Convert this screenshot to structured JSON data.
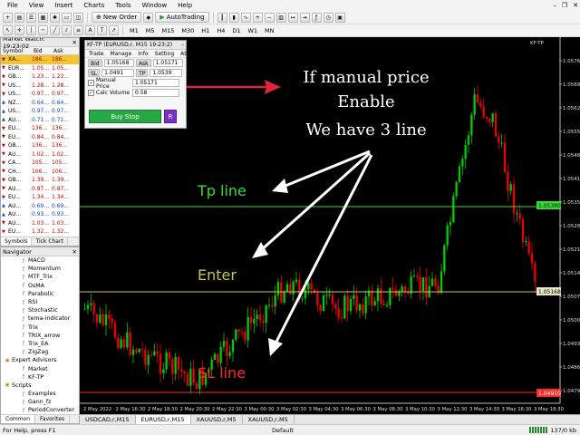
{
  "menu": [
    "File",
    "View",
    "Insert",
    "Charts",
    "Tools",
    "Window",
    "Help"
  ],
  "toolbar": {
    "new_order": "New Order",
    "autotrading": "AutoTrading",
    "timeframes": [
      "M1",
      "M5",
      "M15",
      "M30",
      "H1",
      "H4",
      "D1",
      "W1",
      "MN"
    ]
  },
  "market_watch": {
    "title": "Market Watch: 19:23:02",
    "headers": [
      "Symbol",
      "Bid",
      "Ask"
    ],
    "rows": [
      {
        "symbol": "XA...",
        "bid": "186...",
        "ask": "186...",
        "selected": true
      },
      {
        "symbol": "EUR...",
        "bid": "1.05...",
        "ask": "1.05..."
      },
      {
        "symbol": "GB...",
        "bid": "1.23...",
        "ask": "1.23..."
      },
      {
        "symbol": "US...",
        "bid": "1.28...",
        "ask": "1.28..."
      },
      {
        "symbol": "US...",
        "bid": "0.97...",
        "ask": "0.97..."
      },
      {
        "symbol": "NZ...",
        "bid": "0.64...",
        "ask": "0.64...",
        "blue": true
      },
      {
        "symbol": "US...",
        "bid": "0.97...",
        "ask": "0.97...",
        "blue": true
      },
      {
        "symbol": "AU...",
        "bid": "0.71...",
        "ask": "0.71...",
        "blue": true
      },
      {
        "symbol": "EU...",
        "bid": "136...",
        "ask": "136..."
      },
      {
        "symbol": "EU...",
        "bid": "0.84...",
        "ask": "0.84..."
      },
      {
        "symbol": "GB...",
        "bid": "136...",
        "ask": "136..."
      },
      {
        "symbol": "AU...",
        "bid": "1.02...",
        "ask": "1.02..."
      },
      {
        "symbol": "CA...",
        "bid": "105...",
        "ask": "105..."
      },
      {
        "symbol": "CH...",
        "bid": "106...",
        "ask": "106..."
      },
      {
        "symbol": "GB...",
        "bid": "1.39...",
        "ask": "1.39..."
      },
      {
        "symbol": "AU...",
        "bid": "0.87...",
        "ask": "0.87..."
      },
      {
        "symbol": "EU...",
        "bid": "1.34...",
        "ask": "1.34..."
      },
      {
        "symbol": "AU...",
        "bid": "0.69...",
        "ask": "0.69...",
        "blue": true
      },
      {
        "symbol": "AU...",
        "bid": "0.93...",
        "ask": "0.93...",
        "blue": true
      },
      {
        "symbol": "AU...",
        "bid": "1.03...",
        "ask": "1.03..."
      },
      {
        "symbol": "EU...",
        "bid": "1.32...",
        "ask": "1.32..."
      }
    ],
    "tabs": [
      "Symbols",
      "Tick Chart"
    ]
  },
  "navigator": {
    "title": "Navigator",
    "items": [
      {
        "label": "MACD",
        "level": 2
      },
      {
        "label": "Momentum",
        "level": 2
      },
      {
        "label": "MTF_Trix",
        "level": 2
      },
      {
        "label": "OsMA",
        "level": 2
      },
      {
        "label": "Parabolic",
        "level": 2
      },
      {
        "label": "RSI",
        "level": 2
      },
      {
        "label": "Stochastic",
        "level": 2
      },
      {
        "label": "tema-indicator",
        "level": 2
      },
      {
        "label": "Trix",
        "level": 2
      },
      {
        "label": "TRIX_arrow",
        "level": 2
      },
      {
        "label": "Trix_EA",
        "level": 2
      },
      {
        "label": "ZigZag",
        "level": 2
      },
      {
        "label": "Expert Advisors",
        "level": 1
      },
      {
        "label": "Market",
        "level": 2
      },
      {
        "label": "KF-TP",
        "level": 2
      },
      {
        "label": "Scripts",
        "level": 1
      },
      {
        "label": "Examples",
        "level": 2
      },
      {
        "label": "Gann_fz",
        "level": 2
      },
      {
        "label": "PeriodConverter",
        "level": 2
      }
    ],
    "tabs": [
      "Common",
      "Favorites"
    ]
  },
  "panel": {
    "title": "KF-TP (EURUSD,r, M15 19:23:2)",
    "menu": [
      "Trade",
      "Manage",
      "Info",
      "Setting",
      "About"
    ],
    "bid_label": "Bid",
    "bid_value": "1.05168",
    "ask_label": "Ask",
    "ask_value": "1.05171",
    "sl_label": "SL",
    "sl_value": "1.0491",
    "tp_label": "TP",
    "tp_value": "1.0539",
    "manual_price_label": "Manual Price",
    "manual_price_value": "1.05171",
    "calc_volume_label": "Calc Volume",
    "calc_volume_value": "0.58",
    "buy_stop": "Buy Stop",
    "r_button": "R"
  },
  "chart": {
    "info": "EURUSD,r,M15",
    "price_axis": [
      "1.05765",
      "1.05695",
      "1.05625",
      "1.05555",
      "1.05485",
      "1.05415",
      "1.05350",
      "1.05280",
      "1.05210",
      "1.05140",
      "1.05070",
      "1.05000",
      "1.04930",
      "1.04860",
      "1.04790"
    ],
    "tp_price": "1.05390",
    "enter_price": "1.05168",
    "sl_price": "1.04910",
    "time_axis": [
      "2 May 2022",
      "2 May 16:30",
      "2 May 18:30",
      "2 May 20:30",
      "2 May 22:30",
      "3 May 00:30",
      "3 May 02:30",
      "3 May 04:30",
      "3 May 06:30",
      "3 May 08:30",
      "3 May 10:30",
      "3 May 12:30",
      "3 May 14:30",
      "3 May 16:30",
      "3 May 18:30"
    ],
    "annotation_main": [
      "If manual price",
      "Enable",
      "We have 3 line"
    ],
    "label_tp": "Tp line",
    "label_enter": "Enter",
    "label_sl": "SL line",
    "colors": {
      "tp": "#33dd33",
      "enter": "#c8c850",
      "sl": "#ff2a2a",
      "bull": "#00cc00",
      "bear": "#ee0000",
      "arrow": "#e0243c"
    }
  },
  "chart_tabs": [
    "USDCAD,r,M15",
    "EURUSD,r,M15",
    "XAUUSD,r,M5",
    "XAUUSD,r,M5"
  ],
  "status": {
    "help": "For Help, press F1",
    "profile": "Default",
    "traffic": "137/0 kb"
  }
}
